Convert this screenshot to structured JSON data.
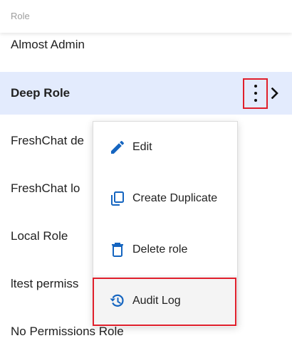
{
  "header": {
    "label": "Role"
  },
  "roles": [
    {
      "name": "Almost Admin"
    },
    {
      "name": "Deep Role",
      "selected": true
    },
    {
      "name": "FreshChat de"
    },
    {
      "name": "FreshChat lo"
    },
    {
      "name": "Local Role"
    },
    {
      "name": "ltest permiss"
    },
    {
      "name": "No Permissions Role"
    }
  ],
  "row_actions": {
    "more_icon": "more-vert-icon",
    "chevron_icon": "chevron-right-icon"
  },
  "context_menu": {
    "items": [
      {
        "label": "Edit",
        "icon": "pencil-icon"
      },
      {
        "label": "Create Duplicate",
        "icon": "copy-icon"
      },
      {
        "label": "Delete role",
        "icon": "trash-icon"
      },
      {
        "label": "Audit Log",
        "icon": "history-icon",
        "highlighted": true
      }
    ]
  },
  "colors": {
    "accent": "#1565c0",
    "selected_row": "#e3ebfd",
    "annotation": "#e01f2b"
  }
}
